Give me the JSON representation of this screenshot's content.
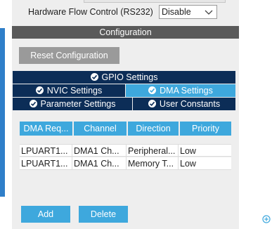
{
  "hardware_flow_control": {
    "label": "Hardware Flow Control (RS232)",
    "value": "Disable"
  },
  "configuration": {
    "title": "Configuration",
    "reset_label": "Reset Configuration",
    "tabs": {
      "gpio": "GPIO Settings",
      "nvic": "NVIC Settings",
      "dma": "DMA Settings",
      "parameter": "Parameter Settings",
      "user_constants": "User Constants"
    },
    "active_tab": "DMA Settings"
  },
  "dma_table": {
    "headers": [
      "DMA Req...",
      "Channel",
      "Direction",
      "Priority"
    ],
    "rows": [
      [
        "LPUART1...",
        "DMA1 Ch...",
        "Peripheral...",
        "Low"
      ],
      [
        "LPUART1...",
        "DMA1 Ch...",
        "Memory T...",
        "Low"
      ]
    ]
  },
  "buttons": {
    "add": "Add",
    "delete": "Delete"
  },
  "colors": {
    "tab_dark": "#0c2d57",
    "accent": "#3ea8dd",
    "header_gray": "#5a5a5a",
    "disabled_button": "#9a9a9a"
  },
  "icons": {
    "tab_check": "check-circle-icon",
    "dropdown": "chevron-down-icon",
    "add_circle": "plus-circle-icon"
  }
}
